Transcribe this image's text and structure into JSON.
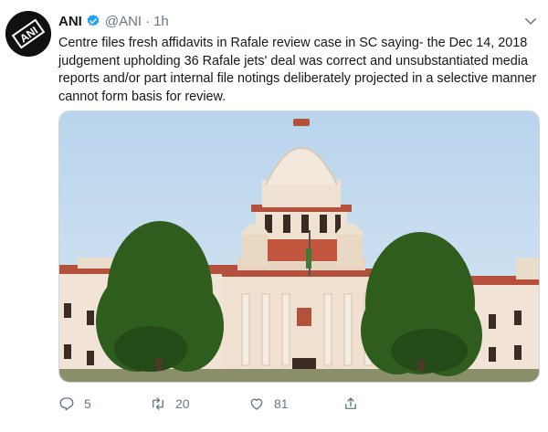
{
  "tweet": {
    "author_name": "ANI",
    "handle": "@ANI",
    "separator": "·",
    "time": "1h",
    "text": "Centre files fresh affidavits in Rafale review case in SC saying- the Dec 14, 2018 judgement upholding 36 Rafale jets' deal was correct and unsubstantiated media reports and/or part internal file notings deliberately projected in a selective manner cannot form basis for review.",
    "avatar_logo_text": "ANI",
    "icons": {
      "verified": "verified-badge-icon",
      "menu": "chevron-down-icon",
      "reply": "reply-icon",
      "retweet": "retweet-icon",
      "like": "like-icon",
      "share": "share-icon"
    },
    "colors": {
      "verified": "#1da1f2",
      "muted": "#657786",
      "text": "#14171a"
    }
  },
  "actions": {
    "replies": "5",
    "retweets": "20",
    "likes": "81"
  }
}
